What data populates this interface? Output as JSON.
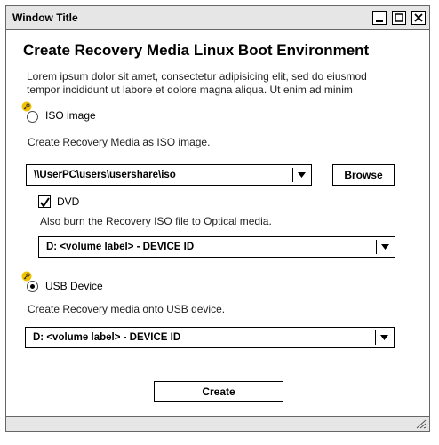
{
  "window": {
    "title": "Window Title"
  },
  "heading": "Create Recovery Media  Linux Boot Environment",
  "description": [
    "Lorem ipsum dolor sit amet, consectetur adipisicing elit, sed do eiusmod",
    "tempor incididunt ut labore et dolore magna aliqua. Ut enim ad minim"
  ],
  "iso": {
    "option_label": "ISO image",
    "selected": false,
    "sublabel": "Create Recovery Media as ISO image.",
    "path": "\\\\UserPC\\users\\usershare\\iso",
    "browse_label": "Browse",
    "dvd": {
      "label": "DVD",
      "checked": true,
      "sublabel": "Also burn the Recovery ISO file to Optical media.",
      "device": "D: <volume label> - DEVICE ID"
    }
  },
  "usb": {
    "option_label": "USB Device",
    "selected": true,
    "sublabel": "Create Recovery media onto USB device.",
    "device": "D: <volume label> - DEVICE ID"
  },
  "create_label": "Create"
}
